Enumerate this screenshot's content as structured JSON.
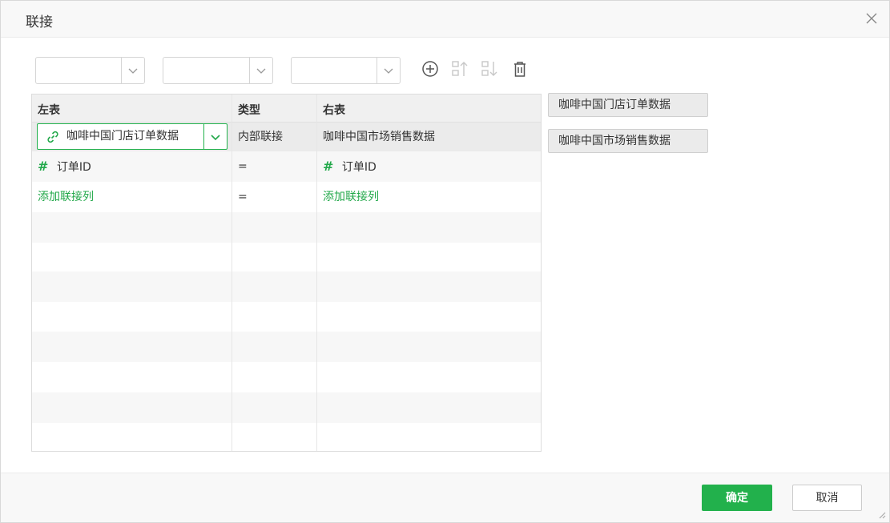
{
  "dialog": {
    "title": "联接",
    "close_icon": "close-icon"
  },
  "toolbar": {
    "selects": [
      {
        "value": ""
      },
      {
        "value": ""
      },
      {
        "value": ""
      }
    ],
    "icons": [
      "add-circle-icon",
      "move-up-icon",
      "move-down-icon",
      "trash-icon"
    ]
  },
  "grid": {
    "columns": [
      "左表",
      "类型",
      "右表"
    ],
    "join_row": {
      "left_table": "咖啡中国门店订单数据",
      "type": "内部联接",
      "right_table": "咖啡中国市场销售数据"
    },
    "field_rows": [
      {
        "left_field": "订单ID",
        "op": "=",
        "right_field": "订单ID"
      }
    ],
    "add_row": {
      "left_label": "添加联接列",
      "op": "=",
      "right_label": "添加联接列"
    }
  },
  "side_tables": [
    "咖啡中国门店订单数据",
    "咖啡中国市场销售数据"
  ],
  "footer": {
    "ok_label": "确定",
    "cancel_label": "取消"
  },
  "colors": {
    "accent": "#22b14c"
  }
}
